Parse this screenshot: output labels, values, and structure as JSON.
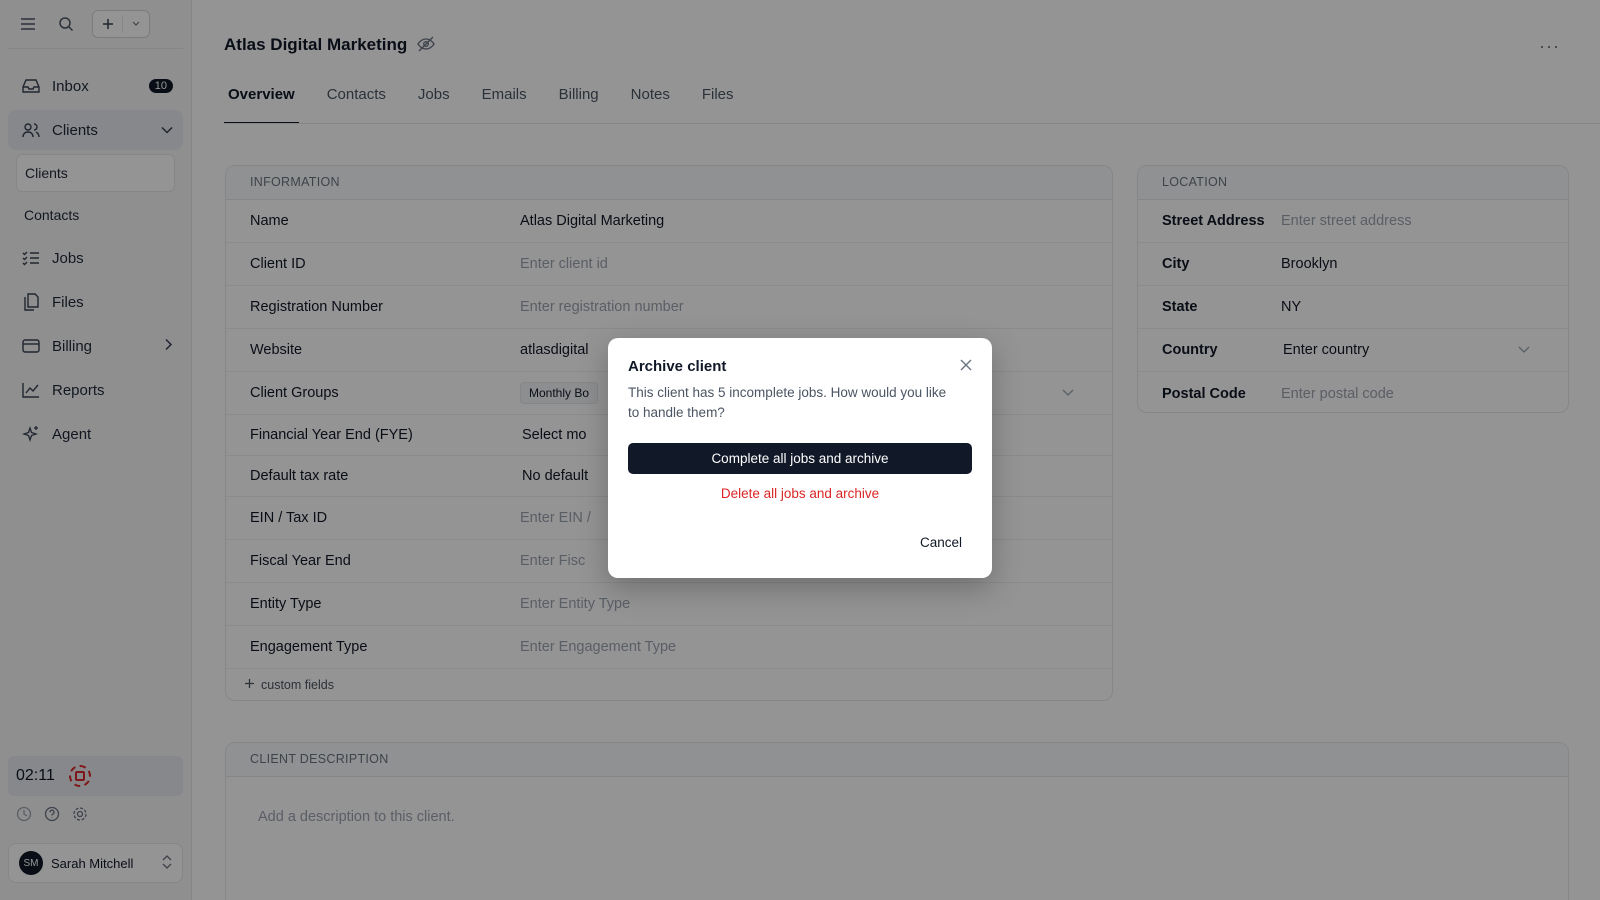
{
  "sidebar": {
    "inbox": {
      "label": "Inbox",
      "count": "10"
    },
    "clients": {
      "label": "Clients",
      "sub": [
        {
          "label": "Clients"
        },
        {
          "label": "Contacts"
        }
      ]
    },
    "jobs": "Jobs",
    "files": "Files",
    "billing": "Billing",
    "reports": "Reports",
    "agent": "Agent",
    "timer": "02:11",
    "user": {
      "initials": "SM",
      "name": "Sarah Mitchell"
    }
  },
  "header": {
    "title": "Atlas Digital Marketing",
    "tabs": [
      "Overview",
      "Contacts",
      "Jobs",
      "Emails",
      "Billing",
      "Notes",
      "Files"
    ]
  },
  "information": {
    "heading": "INFORMATION",
    "name_label": "Name",
    "name_value": "Atlas Digital Marketing",
    "client_id_label": "Client ID",
    "client_id_placeholder": "Enter client id",
    "reg_label": "Registration Number",
    "reg_placeholder": "Enter registration number",
    "website_label": "Website",
    "website_value": "atlasdigital",
    "groups_label": "Client Groups",
    "groups_value": "Monthly Bo",
    "fye_label": "Financial Year End (FYE)",
    "fye_value": "Select mo",
    "tax_label": "Default tax rate",
    "tax_value": "No default",
    "ein_label": "EIN / Tax ID",
    "ein_placeholder": "Enter EIN /",
    "fiscal_label": "Fiscal Year End",
    "fiscal_placeholder": "Enter Fisc",
    "entity_label": "Entity Type",
    "entity_placeholder": "Enter Entity Type",
    "engagement_label": "Engagement Type",
    "engagement_placeholder": "Enter Engagement Type",
    "custom_fields": "custom fields"
  },
  "location": {
    "heading": "LOCATION",
    "street_label": "Street Address",
    "street_placeholder": "Enter street address",
    "city_label": "City",
    "city_value": "Brooklyn",
    "state_label": "State",
    "state_value": "NY",
    "country_label": "Country",
    "country_placeholder": "Enter country",
    "postal_label": "Postal Code",
    "postal_placeholder": "Enter postal code"
  },
  "description": {
    "heading": "CLIENT DESCRIPTION",
    "placeholder": "Add a description to this client."
  },
  "modal": {
    "title": "Archive client",
    "message": "This client has 5 incomplete jobs. How would you like to handle them?",
    "primary": "Complete all jobs and archive",
    "danger": "Delete all jobs and archive",
    "cancel": "Cancel"
  }
}
